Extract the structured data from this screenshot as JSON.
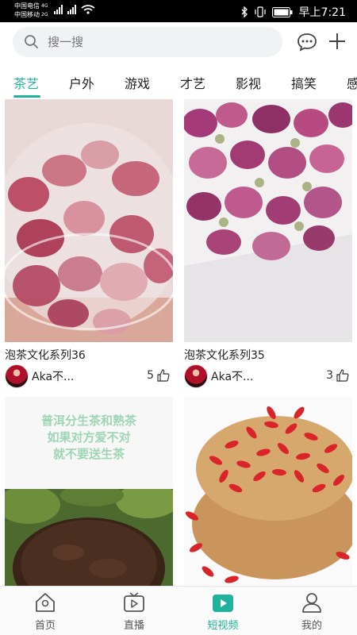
{
  "status_bar": {
    "carrier_1": "中国电信",
    "carrier_1_net": "4G",
    "carrier_2": "中国移动",
    "carrier_2_net": "2G",
    "time": "早上7:21"
  },
  "search": {
    "placeholder": "搜一搜"
  },
  "tabs": [
    {
      "label": "茶艺",
      "active": true
    },
    {
      "label": "户外"
    },
    {
      "label": "游戏"
    },
    {
      "label": "才艺"
    },
    {
      "label": "影视"
    },
    {
      "label": "搞笑"
    },
    {
      "label": "感"
    }
  ],
  "cards": [
    {
      "title": "泡茶文化系列36",
      "author": "Aka不...",
      "likes": "5"
    },
    {
      "title": "泡茶文化系列35",
      "author": "Aka不...",
      "likes": "3"
    },
    {
      "overlay_text": [
        "普洱分生茶和熟茶",
        "如果对方爱不对",
        "就不要送生茶"
      ]
    },
    {}
  ],
  "bottom_nav": [
    {
      "label": "首页",
      "icon": "home-icon"
    },
    {
      "label": "直播",
      "icon": "tv-icon"
    },
    {
      "label": "短视频",
      "icon": "play-icon",
      "active": true
    },
    {
      "label": "我的",
      "icon": "person-icon"
    }
  ],
  "colors": {
    "accent": "#1fb29c",
    "status_bar_bg": "#000000"
  }
}
